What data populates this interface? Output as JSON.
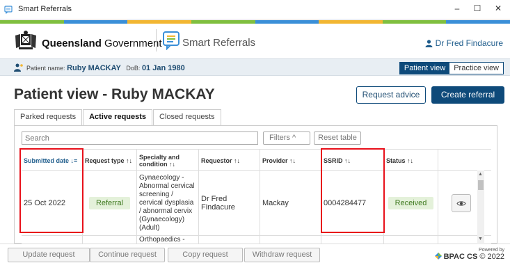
{
  "window": {
    "title": "Smart Referrals",
    "minimize": "–",
    "maximize": "☐",
    "close": "✕"
  },
  "header": {
    "gov_bold": "Queensland",
    "gov_rest": " Government",
    "app_name": "Smart Referrals",
    "user_name": "Dr Fred Findacure"
  },
  "patient_bar": {
    "label": "Patient name:",
    "name": "Ruby MACKAY",
    "dob_label": "DoB:",
    "dob": "01 Jan 1980",
    "view_patient": "Patient view",
    "view_practice": "Practice view"
  },
  "page": {
    "title": "Patient view - Ruby MACKAY",
    "request_advice": "Request advice",
    "create_referral": "Create referral"
  },
  "tabs": [
    "Parked requests",
    "Active requests",
    "Closed requests"
  ],
  "toolbar": {
    "search_placeholder": "Search",
    "filters": "Filters  ^",
    "reset": "Reset table"
  },
  "table": {
    "headers": {
      "submitted": "Submitted date ↓≡",
      "request_type": "Request type ↑↓",
      "specialty": "Specialty and condition ↑↓",
      "requestor": "Requestor ↑↓",
      "provider": "Provider ↑↓",
      "ssrid": "SSRID ↑↓",
      "status": "Status ↑↓"
    },
    "rows": [
      {
        "submitted": "25 Oct 2022",
        "request_type": "Referral",
        "specialty": "Gynaecology - Abnormal cervical screening / cervical dysplasia / abnormal cervix (Gynaecology) (Adult)",
        "requestor": "Dr Fred Findacure",
        "provider": "Mackay",
        "ssrid": "0004284477",
        "status": "Received"
      },
      {
        "specialty": "Orthopaedics -"
      }
    ]
  },
  "footer": {
    "update": "Update request",
    "continue": "Continue request",
    "copy": "Copy request",
    "withdraw": "Withdraw request",
    "powered_by": "Powered by",
    "brand": "BPAC CS",
    "copyright": "© 2022"
  },
  "colors": {
    "primary": "#0e4a7a",
    "highlight_box": "#e8101a",
    "received_bg": "#e4f1da"
  }
}
